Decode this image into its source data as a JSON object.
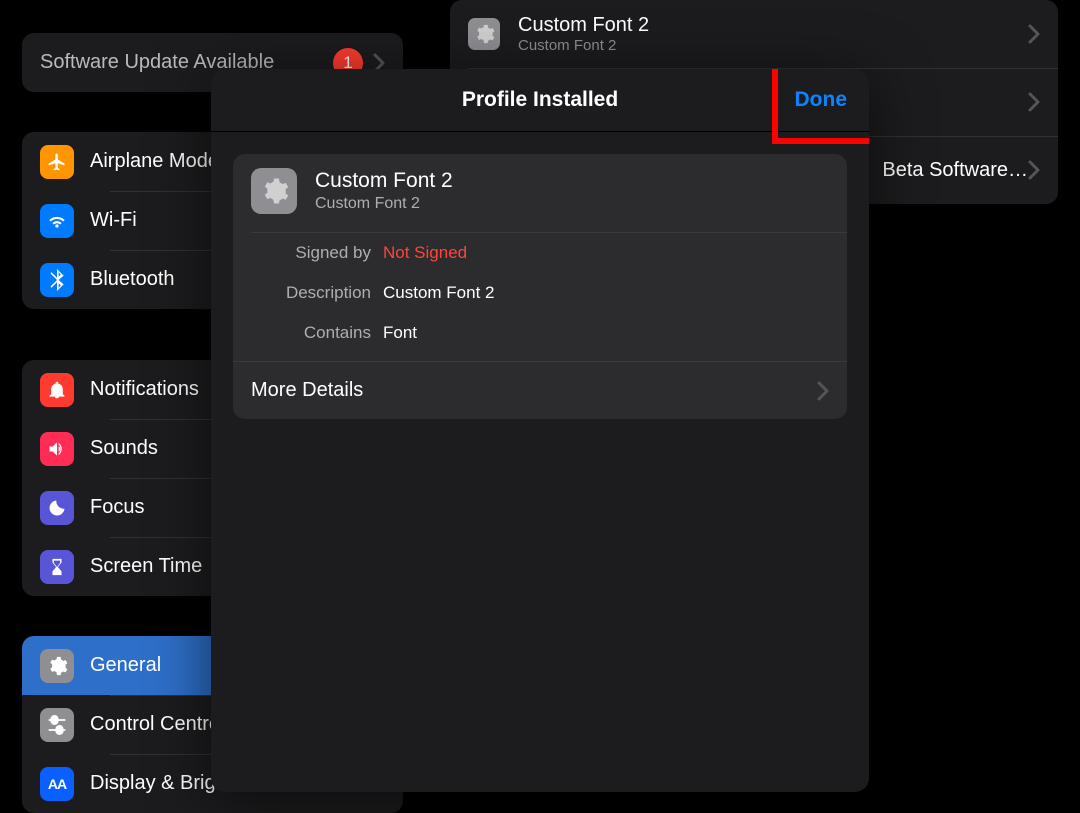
{
  "update_banner": {
    "label": "Software Update Available",
    "badge": "1"
  },
  "sidebar_groups": [
    {
      "items": [
        {
          "name": "airplane-mode",
          "label": "Airplane Mode",
          "icon": "airplane",
          "bg": "bg-orange"
        },
        {
          "name": "wifi",
          "label": "Wi-Fi",
          "icon": "wifi",
          "bg": "bg-blue"
        },
        {
          "name": "bluetooth",
          "label": "Bluetooth",
          "icon": "bluetooth",
          "bg": "bg-blue"
        }
      ]
    },
    {
      "items": [
        {
          "name": "notifications",
          "label": "Notifications",
          "icon": "bell",
          "bg": "bg-red"
        },
        {
          "name": "sounds",
          "label": "Sounds",
          "icon": "speaker",
          "bg": "bg-redpink"
        },
        {
          "name": "focus",
          "label": "Focus",
          "icon": "moon",
          "bg": "bg-indigo"
        },
        {
          "name": "screen-time",
          "label": "Screen Time",
          "icon": "hourglass",
          "bg": "bg-indigo"
        }
      ]
    },
    {
      "items": [
        {
          "name": "general",
          "label": "General",
          "icon": "gear",
          "bg": "bg-grey",
          "selected": true
        },
        {
          "name": "control-centre",
          "label": "Control Centre",
          "icon": "switches",
          "bg": "bg-grey"
        },
        {
          "name": "display-brightness",
          "label": "Display & Brightness",
          "icon": "aa",
          "bg": "bg-bluea"
        }
      ]
    }
  ],
  "content_rows": [
    {
      "title": "Custom Font 2",
      "subtitle": "Custom Font 2",
      "has_icon": true
    },
    {
      "title": "",
      "subtitle": "",
      "has_icon": false
    },
    {
      "title": "",
      "trailing": "Beta Software…",
      "has_icon": false
    }
  ],
  "modal": {
    "title": "Profile Installed",
    "done": "Done",
    "profile": {
      "title": "Custom Font 2",
      "subtitle": "Custom Font 2",
      "fields": {
        "signed_by_label": "Signed by",
        "signed_by_value": "Not Signed",
        "description_label": "Description",
        "description_value": "Custom Font 2",
        "contains_label": "Contains",
        "contains_value": "Font"
      },
      "more_details": "More Details"
    }
  }
}
